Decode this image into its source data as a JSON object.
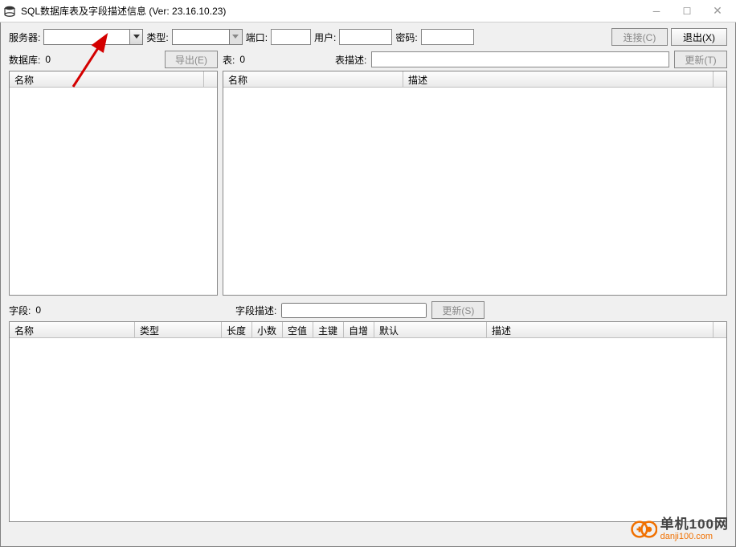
{
  "window": {
    "title": "SQL数据库表及字段描述信息 (Ver: 23.16.10.23)"
  },
  "conn": {
    "server_label": "服务器:",
    "server_value": "",
    "type_label": "类型:",
    "type_value": "",
    "port_label": "端口:",
    "port_value": "",
    "user_label": "用户:",
    "user_value": "",
    "pwd_label": "密码:",
    "pwd_value": "",
    "connect_btn": "连接(C)",
    "exit_btn": "退出(X)"
  },
  "db": {
    "label": "数据库:",
    "count": "0",
    "export_btn": "导出(E)",
    "col_name": "名称"
  },
  "tbl": {
    "label": "表:",
    "count": "0",
    "desc_label": "表描述:",
    "desc_value": "",
    "update_btn": "更新(T)",
    "col_name": "名称",
    "col_desc": "描述"
  },
  "fld": {
    "label": "字段:",
    "count": "0",
    "desc_label": "字段描述:",
    "desc_value": "",
    "update_btn": "更新(S)",
    "col_name": "名称",
    "col_type": "类型",
    "col_len": "长度",
    "col_dec": "小数",
    "col_null": "空值",
    "col_pk": "主键",
    "col_auto": "自增",
    "col_def": "默认",
    "col_desc": "描述"
  },
  "watermark": {
    "cn": "单机100网",
    "url": "danji100.com"
  }
}
